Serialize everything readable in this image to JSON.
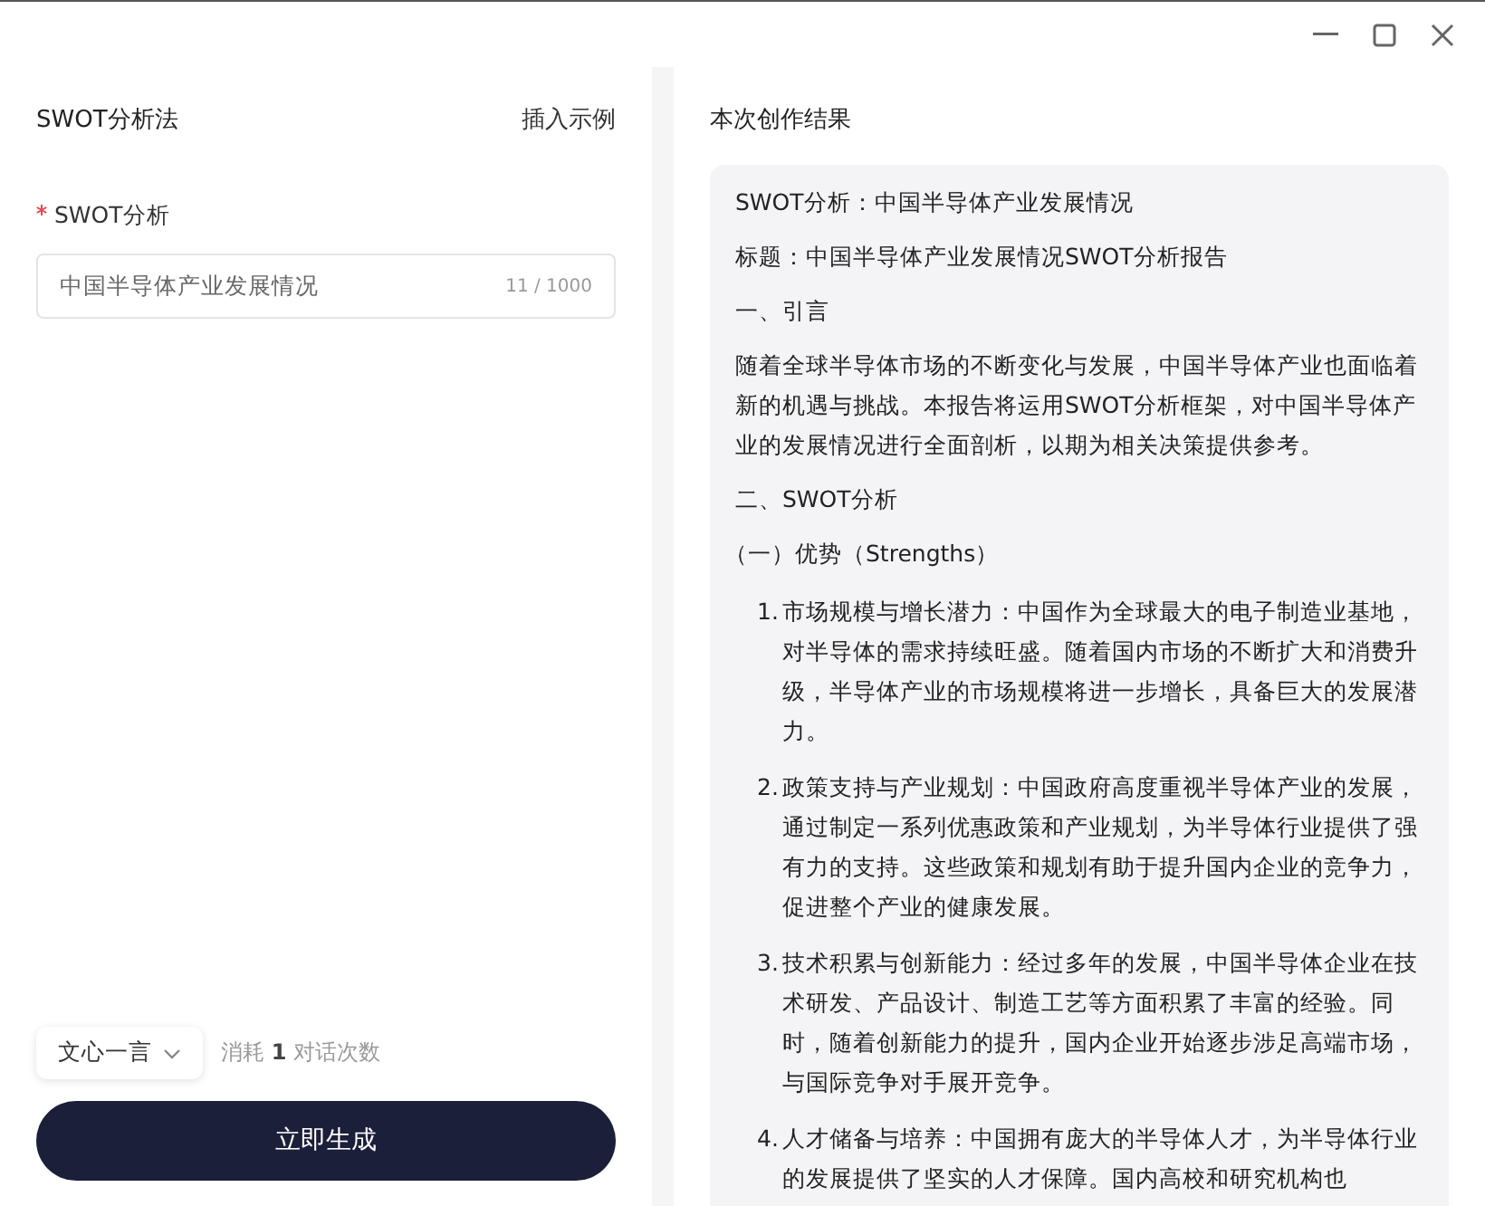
{
  "window": {
    "controls": [
      {
        "kind": "minimize"
      },
      {
        "kind": "maximize"
      },
      {
        "kind": "close"
      }
    ]
  },
  "form": {
    "title": "SWOT分析法",
    "insert_example": "插入示例",
    "field_label": "SWOT分析",
    "required": true,
    "value": "中国半导体产业发展情况",
    "counter": "11 / 1000",
    "model": "文心一言",
    "cost_prefix": "消耗",
    "cost_count": "1",
    "cost_suffix": "对话次数",
    "generate": "立即生成"
  },
  "result": {
    "title": "本次创作结果",
    "blocks": [
      {
        "kind": "para",
        "text": "SWOT分析：中国半导体产业发展情况"
      },
      {
        "kind": "para",
        "text": "标题：中国半导体产业发展情况SWOT分析报告"
      },
      {
        "kind": "para",
        "text": "一、引言"
      },
      {
        "kind": "para",
        "text": "随着全球半导体市场的不断变化与发展，中国半导体产业也面临着新的机遇与挑战。本报告将运用SWOT分析框架，对中国半导体产业的发展情况进行全面剖析，以期为相关决策提供参考。"
      },
      {
        "kind": "para",
        "text": "二、SWOT分析"
      },
      {
        "kind": "sub",
        "text": "（一）优势（Strengths）"
      },
      {
        "kind": "item",
        "number": "1.",
        "text": "市场规模与增长潜力：中国作为全球最大的电子制造业基地，对半导体的需求持续旺盛。随着国内市场的不断扩大和消费升级，半导体产业的市场规模将进一步增长，具备巨大的发展潜力。"
      },
      {
        "kind": "item",
        "number": "2.",
        "text": "政策支持与产业规划：中国政府高度重视半导体产业的发展，通过制定一系列优惠政策和产业规划，为半导体行业提供了强有力的支持。这些政策和规划有助于提升国内企业的竞争力，促进整个产业的健康发展。"
      },
      {
        "kind": "item",
        "number": "3.",
        "text": "技术积累与创新能力：经过多年的发展，中国半导体企业在技术研发、产品设计、制造工艺等方面积累了丰富的经验。同时，随着创新能力的提升，国内企业开始逐步涉足高端市场，与国际竞争对手展开竞争。"
      },
      {
        "kind": "item",
        "number": "4.",
        "text": "人才储备与培养：中国拥有庞大的半导体人才，为半导体行业的发展提供了坚实的人才保障。国内高校和研究机构也"
      }
    ]
  }
}
